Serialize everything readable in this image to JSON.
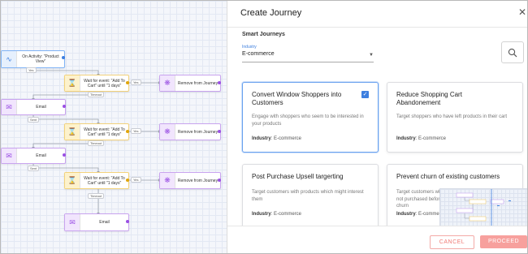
{
  "canvas": {
    "trigger_label": "On Activity: \"Product View\"",
    "wait_label": "Wait for event: \"Add To Cart\" until \"1 days\"",
    "email_label": "Email",
    "remove_label": "Remove from Journey",
    "yes_tag": "Yes",
    "timeout_tag": "Timeout",
    "sent_tag": "Sent"
  },
  "panel": {
    "title": "Create Journey",
    "close_icon": "close-icon",
    "section_title": "Smart Journeys",
    "industry_label": "Industry",
    "industry_value": "E-commerce",
    "search_icon": "search-icon"
  },
  "cards": [
    {
      "title": "Convert Window Shoppers into Customers",
      "desc": "Engage with shoppers who seem to be interested in your products",
      "industry_label": "Industry",
      "industry_value": ": E-commerce",
      "selected": true
    },
    {
      "title": "Reduce Shopping Cart Abandonement",
      "desc": "Target shoppers who have left products in their cart",
      "industry_label": "Industry",
      "industry_value": ": E-commerce",
      "selected": false
    },
    {
      "title": "Post Purchase Upsell targerting",
      "desc": "Target customers with products which might interest them",
      "industry_label": "Industry",
      "industry_value": ": E-commerce",
      "selected": false
    },
    {
      "title": "Prevent churn of existing customers",
      "desc": "Target customers who have not purchased before they churn",
      "industry_label": "Industry",
      "industry_value": ": E-commerce",
      "selected": false
    }
  ],
  "footer": {
    "cancel_label": "CANCEL",
    "proceed_label": "PROCEED"
  },
  "colors": {
    "accent": "#3d7fe0",
    "proceed": "#f7a09d",
    "cancel": "#f07b76",
    "email": "#9a4fe3",
    "wait": "#e0a50b"
  }
}
